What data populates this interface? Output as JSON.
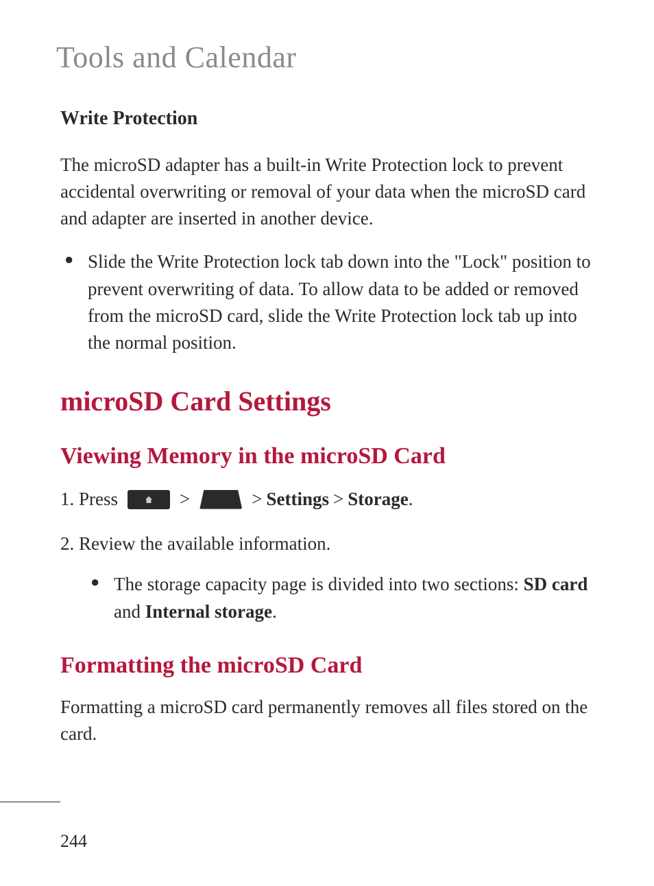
{
  "page": {
    "title": "Tools and Calendar",
    "number": "244"
  },
  "sections": {
    "write_protection": {
      "heading": "Write Protection",
      "paragraph": "The microSD adapter has a built-in Write Protection lock to prevent accidental overwriting or removal of your data when the microSD card and adapter are inserted in another device.",
      "bullet": "Slide the Write Protection lock tab down into the \"Lock\" position to prevent overwriting of data. To allow data to be added or removed from the microSD card, slide the Write Protection lock tab up into the normal position."
    },
    "microsd_settings": {
      "heading": "microSD Card Settings"
    },
    "viewing_memory": {
      "heading": "Viewing Memory in the microSD Card",
      "step1_prefix": "1. Press",
      "step1_settings": "Settings",
      "step1_storage": "Storage",
      "step1_period": ".",
      "step2": "2. Review the available information.",
      "sub_bullet_pre": "The storage capacity page is divided into two sections: ",
      "sub_bullet_bold1": "SD card",
      "sub_bullet_mid": " and ",
      "sub_bullet_bold2": "Internal storage",
      "sub_bullet_end": "."
    },
    "formatting": {
      "heading": "Formatting the microSD Card",
      "paragraph": "Formatting a microSD card permanently removes all files stored on the card."
    }
  },
  "separator": ">"
}
